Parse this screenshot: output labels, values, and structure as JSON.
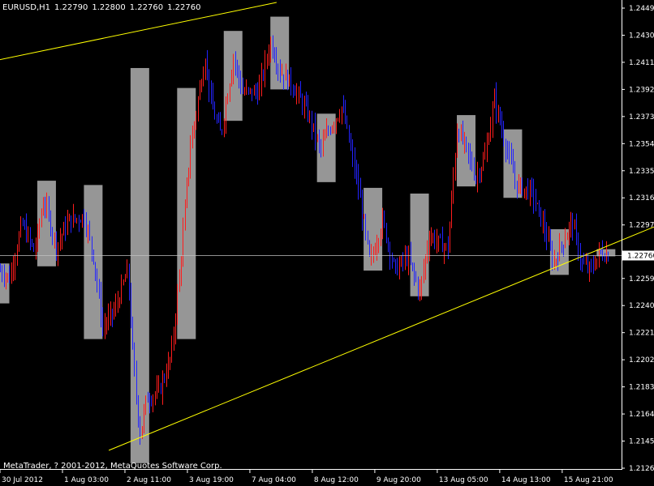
{
  "header": {
    "symbol": "EURUSD,H1",
    "open": "1.22790",
    "high": "1.22800",
    "low": "1.22760",
    "close": "1.22760"
  },
  "copyright": "MetaTrader, ? 2001-2012, MetaQuotes Software Corp.",
  "colors": {
    "background": "#000000",
    "bull": "#ff1c1c",
    "bear": "#2323ff",
    "box": "#c0c0c0",
    "trendline": "#ffff00",
    "price_line": "#c0c0c0",
    "axis": "#ffffff"
  },
  "chart_data": {
    "type": "candlestick",
    "symbol": "EURUSD",
    "timeframe": "H1",
    "current_price": "1.22760",
    "price_ticks": [
      "1.24490",
      "1.24300",
      "1.24110",
      "1.23920",
      "1.23730",
      "1.23540",
      "1.23350",
      "1.23160",
      "1.22970",
      "1.22595",
      "1.22405",
      "1.22215",
      "1.22025",
      "1.21835",
      "1.21645",
      "1.21455",
      "1.21265"
    ],
    "ylim": [
      1.21265,
      1.2449
    ],
    "time_ticks": [
      "30 Jul 2012",
      "1 Aug 03:00",
      "2 Aug 11:00",
      "3 Aug 19:00",
      "7 Aug 04:00",
      "8 Aug 12:00",
      "9 Aug 20:00",
      "13 Aug 05:00",
      "14 Aug 13:00",
      "15 Aug 21:00"
    ],
    "xlim": [
      0,
      100
    ],
    "trend_lines": [
      {
        "x1": -1.0,
        "y1": 1.2412,
        "x2": 44.5,
        "y2": 1.2453
      },
      {
        "x1": 17.5,
        "y1": 1.2139,
        "x2": 120.0,
        "y2": 1.2322
      }
    ],
    "boxes": [
      {
        "x1": 0.0,
        "x2": 1.5,
        "y1": 1.2242,
        "y2": 1.227
      },
      {
        "x1": 6.0,
        "x2": 9.0,
        "y1": 1.2268,
        "y2": 1.2328
      },
      {
        "x1": 13.5,
        "x2": 16.5,
        "y1": 1.2217,
        "y2": 1.2325
      },
      {
        "x1": 21.0,
        "x2": 24.0,
        "y1": 1.213,
        "y2": 1.2407
      },
      {
        "x1": 28.5,
        "x2": 31.5,
        "y1": 1.2217,
        "y2": 1.2393
      },
      {
        "x1": 36.0,
        "x2": 39.0,
        "y1": 1.237,
        "y2": 1.2433
      },
      {
        "x1": 43.5,
        "x2": 46.5,
        "y1": 1.2392,
        "y2": 1.2443
      },
      {
        "x1": 51.0,
        "x2": 54.0,
        "y1": 1.2327,
        "y2": 1.2375
      },
      {
        "x1": 58.5,
        "x2": 61.5,
        "y1": 1.2265,
        "y2": 1.2323
      },
      {
        "x1": 66.0,
        "x2": 69.0,
        "y1": 1.2247,
        "y2": 1.2319
      },
      {
        "x1": 73.5,
        "x2": 76.5,
        "y1": 1.2324,
        "y2": 1.2374
      },
      {
        "x1": 81.0,
        "x2": 84.0,
        "y1": 1.2316,
        "y2": 1.2364
      },
      {
        "x1": 88.5,
        "x2": 91.5,
        "y1": 1.2262,
        "y2": 1.2294
      },
      {
        "x1": 96.0,
        "x2": 99.0,
        "y1": 1.2275,
        "y2": 1.228
      }
    ],
    "waypoints": [
      [
        0.0,
        1.2265
      ],
      [
        1.5,
        1.226
      ],
      [
        3.5,
        1.2298
      ],
      [
        5.5,
        1.2278
      ],
      [
        7.0,
        1.2315
      ],
      [
        9.0,
        1.2282
      ],
      [
        11.0,
        1.23
      ],
      [
        13.5,
        1.2303
      ],
      [
        15.0,
        1.2275
      ],
      [
        16.5,
        1.2225
      ],
      [
        18.5,
        1.2238
      ],
      [
        20.5,
        1.2265
      ],
      [
        21.5,
        1.2195
      ],
      [
        22.5,
        1.215
      ],
      [
        23.5,
        1.2175
      ],
      [
        25.5,
        1.218
      ],
      [
        27.5,
        1.2205
      ],
      [
        29.0,
        1.227
      ],
      [
        30.5,
        1.235
      ],
      [
        32.0,
        1.239
      ],
      [
        33.0,
        1.2415
      ],
      [
        34.0,
        1.238
      ],
      [
        35.5,
        1.236
      ],
      [
        37.5,
        1.2415
      ],
      [
        39.0,
        1.239
      ],
      [
        41.5,
        1.239
      ],
      [
        43.5,
        1.2425
      ],
      [
        45.0,
        1.2405
      ],
      [
        47.0,
        1.2395
      ],
      [
        49.5,
        1.2375
      ],
      [
        51.5,
        1.235
      ],
      [
        53.0,
        1.2365
      ],
      [
        55.0,
        1.238
      ],
      [
        57.5,
        1.2325
      ],
      [
        59.5,
        1.227
      ],
      [
        61.5,
        1.23
      ],
      [
        63.5,
        1.2265
      ],
      [
        65.5,
        1.2275
      ],
      [
        67.5,
        1.225
      ],
      [
        69.0,
        1.229
      ],
      [
        70.5,
        1.2285
      ],
      [
        72.0,
        1.228
      ],
      [
        73.5,
        1.2365
      ],
      [
        75.0,
        1.235
      ],
      [
        76.5,
        1.233
      ],
      [
        78.0,
        1.2345
      ],
      [
        79.5,
        1.2385
      ],
      [
        81.5,
        1.235
      ],
      [
        83.0,
        1.2325
      ],
      [
        85.5,
        1.232
      ],
      [
        87.5,
        1.2295
      ],
      [
        89.0,
        1.227
      ],
      [
        90.5,
        1.2285
      ],
      [
        92.0,
        1.23
      ],
      [
        93.5,
        1.227
      ],
      [
        95.0,
        1.2265
      ],
      [
        96.5,
        1.2278
      ],
      [
        98.0,
        1.2276
      ]
    ]
  }
}
